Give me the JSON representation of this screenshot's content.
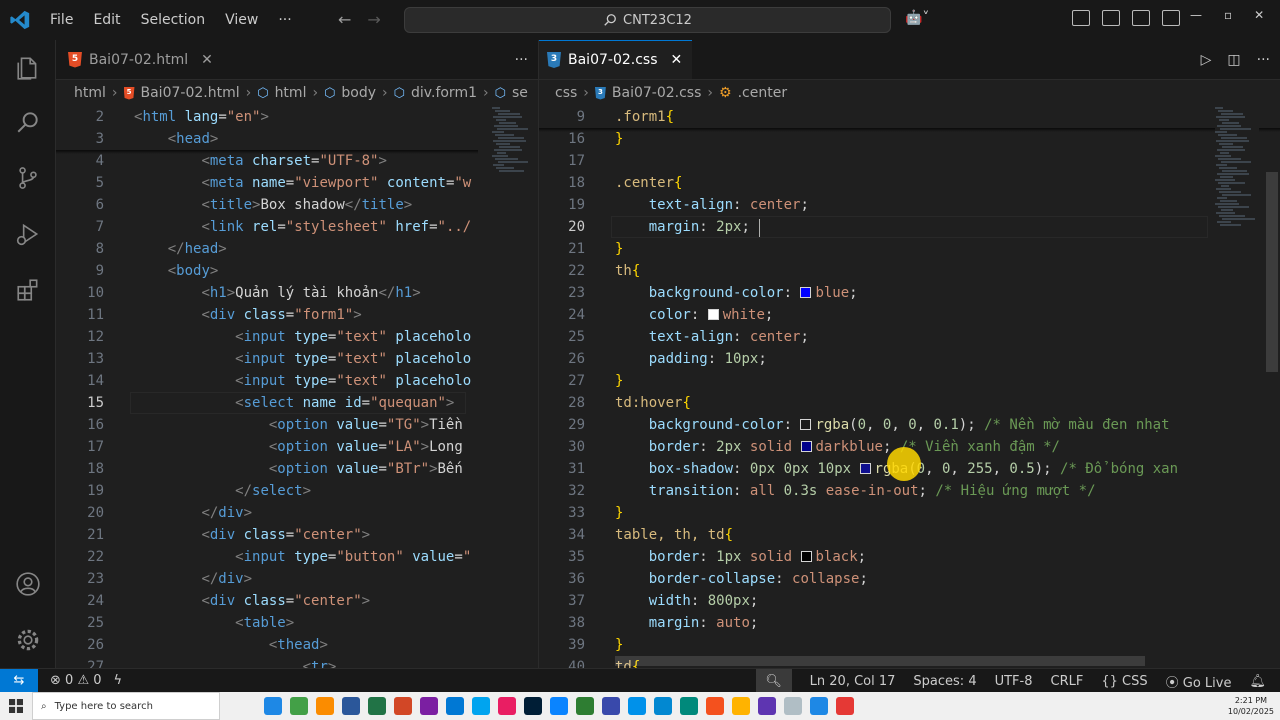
{
  "menu": [
    "File",
    "Edit",
    "Selection",
    "View",
    "···"
  ],
  "search": "CNT23C12",
  "left_tab": {
    "label": "Bai07-02.html"
  },
  "right_tab": {
    "label": "Bai07-02.css"
  },
  "left_breadcrumb": [
    "html",
    "Bai07-02.html",
    "html",
    "body",
    "div.form1",
    "se"
  ],
  "right_breadcrumb": [
    "css",
    "Bai07-02.css",
    ".center"
  ],
  "html_lines": [
    {
      "n": "2",
      "t": "<html lang=\"en\">"
    },
    {
      "n": "3",
      "t": "    <head>"
    },
    {
      "n": "4",
      "t": "        <meta charset=\"UTF-8\">"
    },
    {
      "n": "5",
      "t": "        <meta name=\"viewport\" content=\"w"
    },
    {
      "n": "6",
      "t": "        <title>Box shadow</title>"
    },
    {
      "n": "7",
      "t": "        <link rel=\"stylesheet\" href=\"../"
    },
    {
      "n": "8",
      "t": "    </head>"
    },
    {
      "n": "9",
      "t": "    <body>"
    },
    {
      "n": "10",
      "t": "        <h1>Quản lý tài khoản</h1>"
    },
    {
      "n": "11",
      "t": "        <div class=\"form1\">"
    },
    {
      "n": "12",
      "t": "            <input type=\"text\" placeholo"
    },
    {
      "n": "13",
      "t": "            <input type=\"text\" placeholo"
    },
    {
      "n": "14",
      "t": "            <input type=\"text\" placeholo"
    },
    {
      "n": "15",
      "t": "            <select name id=\"quequan\">"
    },
    {
      "n": "16",
      "t": "                <option value=\"TG\">Tiền"
    },
    {
      "n": "17",
      "t": "                <option value=\"LA\">Long"
    },
    {
      "n": "18",
      "t": "                <option value=\"BTr\">Bến"
    },
    {
      "n": "19",
      "t": "            </select>"
    },
    {
      "n": "20",
      "t": "        </div>"
    },
    {
      "n": "21",
      "t": "        <div class=\"center\">"
    },
    {
      "n": "22",
      "t": "            <input type=\"button\" value=\""
    },
    {
      "n": "23",
      "t": "        </div>"
    },
    {
      "n": "24",
      "t": "        <div class=\"center\">"
    },
    {
      "n": "25",
      "t": "            <table>"
    },
    {
      "n": "26",
      "t": "                <thead>"
    },
    {
      "n": "27",
      "t": "                    <tr>"
    }
  ],
  "css_lines": [
    {
      "n": "9",
      "t": ".form1{"
    },
    {
      "n": "16",
      "t": "}"
    },
    {
      "n": "17",
      "t": ""
    },
    {
      "n": "18",
      "t": ".center{"
    },
    {
      "n": "19",
      "t": "    text-align: center;"
    },
    {
      "n": "20",
      "t": "    margin: 2px;"
    },
    {
      "n": "21",
      "t": "}"
    },
    {
      "n": "22",
      "t": "th{"
    },
    {
      "n": "23",
      "t": "    background-color: blue;"
    },
    {
      "n": "24",
      "t": "    color: white;"
    },
    {
      "n": "25",
      "t": "    text-align: center;"
    },
    {
      "n": "26",
      "t": "    padding: 10px;"
    },
    {
      "n": "27",
      "t": "}"
    },
    {
      "n": "28",
      "t": "td:hover{"
    },
    {
      "n": "29",
      "t": "    background-color: rgba(0, 0, 0, 0.1); /* Nền mờ màu đen nhạt"
    },
    {
      "n": "30",
      "t": "    border: 2px solid darkblue; /* Viền xanh đậm */"
    },
    {
      "n": "31",
      "t": "    box-shadow: 0px 0px 10px rgba(0, 0, 255, 0.5); /* Đổ bóng xan"
    },
    {
      "n": "32",
      "t": "    transition: all 0.3s ease-in-out; /* Hiệu ứng mượt */"
    },
    {
      "n": "33",
      "t": "}"
    },
    {
      "n": "34",
      "t": "table, th, td{"
    },
    {
      "n": "35",
      "t": "    border: 1px solid black;"
    },
    {
      "n": "36",
      "t": "    border-collapse: collapse;"
    },
    {
      "n": "37",
      "t": "    width: 800px;"
    },
    {
      "n": "38",
      "t": "    margin: auto;"
    },
    {
      "n": "39",
      "t": "}"
    },
    {
      "n": "40",
      "t": "td{"
    }
  ],
  "status": {
    "errors": "0",
    "warnings": "0",
    "position": "Ln 20, Col 17",
    "spaces": "Spaces: 4",
    "encoding": "UTF-8",
    "eol": "CRLF",
    "language": "CSS",
    "live": "Go Live"
  },
  "taskbar": {
    "search_placeholder": "Type here to search",
    "time": "2:21 PM",
    "date": "10/02/2025"
  },
  "colors": {
    "accent": "#0078d4",
    "status_remote": "#0078d4"
  }
}
